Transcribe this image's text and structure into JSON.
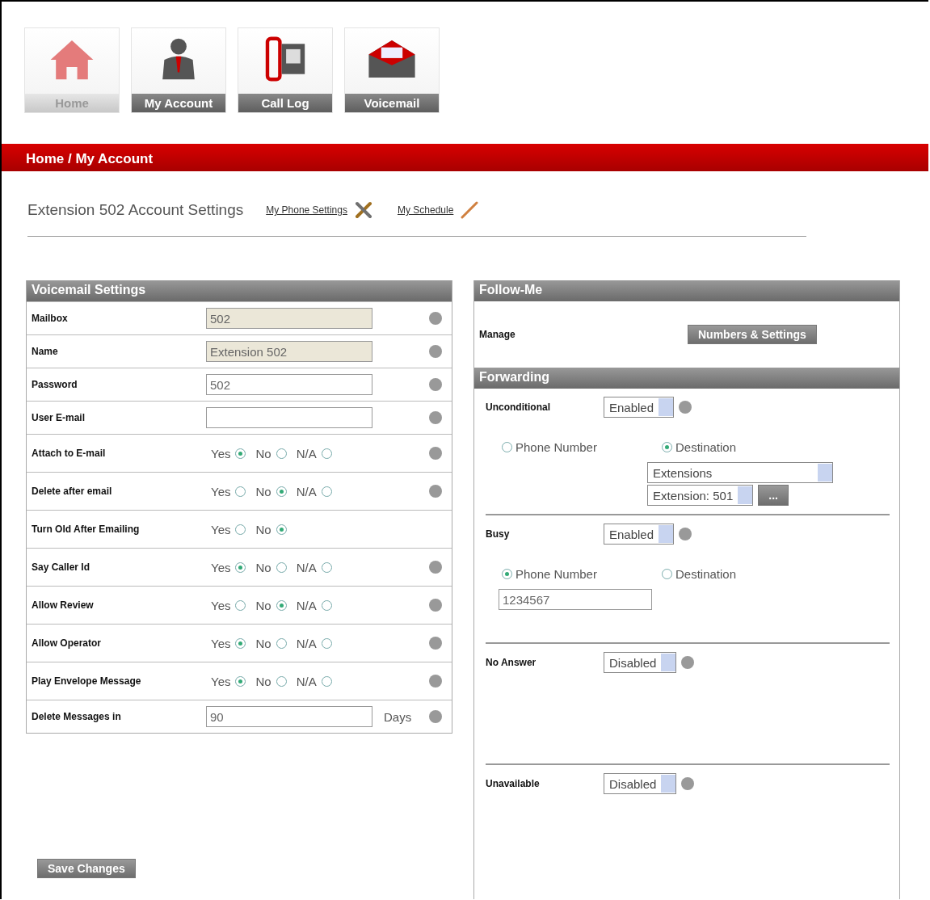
{
  "nav": [
    {
      "label": "Home",
      "selected": true
    },
    {
      "label": "My Account",
      "selected": false
    },
    {
      "label": "Call Log",
      "selected": false
    },
    {
      "label": "Voicemail",
      "selected": false
    }
  ],
  "breadcrumb": "Home / My Account",
  "page_title": "Extension 502 Account Settings",
  "links": [
    {
      "label": "My Phone Settings"
    },
    {
      "label": "My Schedule"
    }
  ],
  "voicemail": {
    "title": "Voicemail Settings",
    "rows": [
      {
        "label": "Mailbox",
        "kind": "text",
        "value": "502",
        "readonly": true,
        "help": true
      },
      {
        "label": "Name",
        "kind": "text",
        "value": "Extension 502",
        "readonly": true,
        "help": true
      },
      {
        "label": "Password",
        "kind": "text",
        "value": "502",
        "readonly": false,
        "help": true
      },
      {
        "label": "User E-mail",
        "kind": "text",
        "readonly": false,
        "help": true
      },
      {
        "label": "Attach to E-mail",
        "kind": "radio",
        "help": true,
        "options": [
          {
            "label": "Yes",
            "selected": true
          },
          {
            "label": "No",
            "selected": false
          },
          {
            "label": "N/A",
            "selected": false
          }
        ]
      },
      {
        "label": "Delete after email",
        "kind": "radio",
        "help": true,
        "options": [
          {
            "label": "Yes",
            "selected": false
          },
          {
            "label": "No",
            "selected": true
          },
          {
            "label": "N/A",
            "selected": false
          }
        ]
      },
      {
        "label": "Turn Old After Emailing",
        "kind": "radio",
        "help": false,
        "options": [
          {
            "label": "Yes",
            "selected": false
          },
          {
            "label": "No",
            "selected": true
          }
        ]
      },
      {
        "label": "Say Caller Id",
        "kind": "radio",
        "help": true,
        "options": [
          {
            "label": "Yes",
            "selected": true
          },
          {
            "label": "No",
            "selected": false
          },
          {
            "label": "N/A",
            "selected": false
          }
        ]
      },
      {
        "label": "Allow Review",
        "kind": "radio",
        "help": true,
        "options": [
          {
            "label": "Yes",
            "selected": false
          },
          {
            "label": "No",
            "selected": true
          },
          {
            "label": "N/A",
            "selected": false
          }
        ]
      },
      {
        "label": "Allow Operator",
        "kind": "radio",
        "help": true,
        "options": [
          {
            "label": "Yes",
            "selected": true
          },
          {
            "label": "No",
            "selected": false
          },
          {
            "label": "N/A",
            "selected": false
          }
        ]
      },
      {
        "label": "Play Envelope Message",
        "kind": "radio",
        "help": true,
        "options": [
          {
            "label": "Yes",
            "selected": true
          },
          {
            "label": "No",
            "selected": false
          },
          {
            "label": "N/A",
            "selected": false
          }
        ]
      },
      {
        "label": "Delete Messages in",
        "kind": "days",
        "value": "90",
        "unit": "Days",
        "help": true
      }
    ]
  },
  "save_button": "Save Changes",
  "follow_me": {
    "title": "Follow-Me",
    "label": "Manage",
    "button": "Numbers & Settings"
  },
  "forwarding": {
    "title": "Forwarding",
    "sections": [
      {
        "label": "Unconditional",
        "select": "Enabled",
        "help": true,
        "targets": [
          {
            "label": "Phone Number",
            "selected": false
          },
          {
            "label": "Destination",
            "selected": true
          }
        ],
        "kind": "destination",
        "destination_type": "Extensions",
        "destination": "Extension: 501",
        "button": "..."
      },
      {
        "label": "Busy",
        "select": "Enabled",
        "help": true,
        "targets": [
          {
            "label": "Phone Number",
            "selected": true
          },
          {
            "label": "Destination",
            "selected": false
          }
        ],
        "kind": "phone",
        "phone": "1234567"
      },
      {
        "label": "No Answer",
        "select": "Disabled",
        "help": true,
        "kind": "none"
      },
      {
        "label": "Unavailable",
        "select": "Disabled",
        "help": true,
        "kind": "none"
      }
    ]
  }
}
